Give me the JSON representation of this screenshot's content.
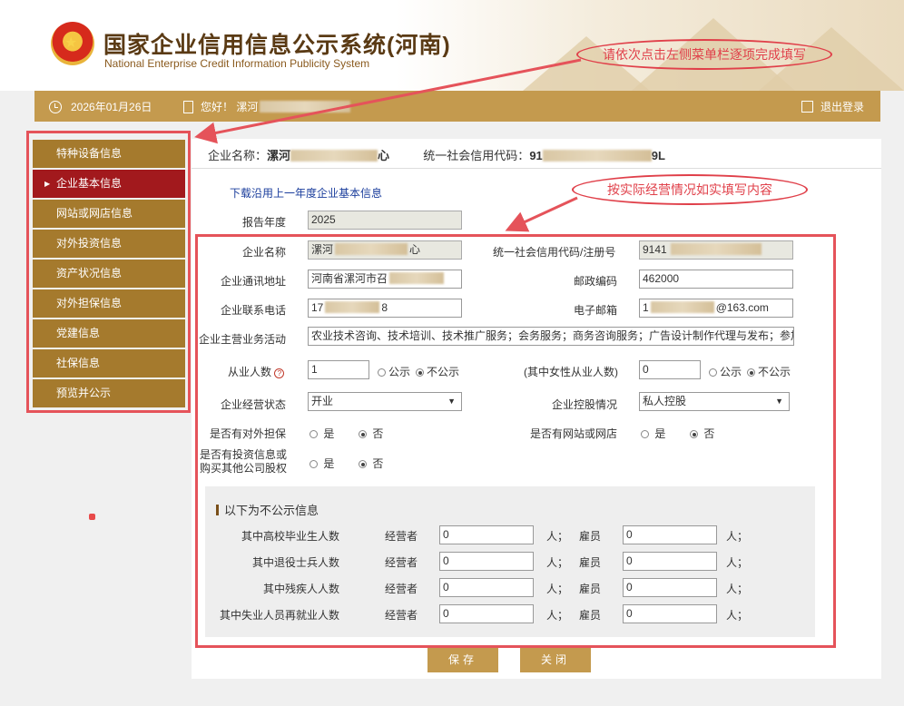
{
  "header": {
    "title_cn": "国家企业信用信息公示系统(河南)",
    "title_en": "National Enterprise Credit Information Publicity System"
  },
  "annotations": {
    "top": "请依次点击左侧菜单栏逐项完成填写",
    "form": "按实际经营情况如实填写内容"
  },
  "topbar": {
    "date": "2026年01月26日",
    "greeting": "您好！ 漯河",
    "logout": "退出登录"
  },
  "sidebar": {
    "items": [
      {
        "label": "特种设备信息"
      },
      {
        "label": "企业基本信息"
      },
      {
        "label": "网站或网店信息"
      },
      {
        "label": "对外投资信息"
      },
      {
        "label": "资产状况信息"
      },
      {
        "label": "对外担保信息"
      },
      {
        "label": "党建信息"
      },
      {
        "label": "社保信息"
      },
      {
        "label": "预览并公示"
      }
    ],
    "active_index": 1
  },
  "company": {
    "name_label": "企业名称：",
    "name_start": "漯河",
    "name_end": "心",
    "credit_label": "统一社会信用代码：",
    "credit_start": "91",
    "credit_end": "9L"
  },
  "form": {
    "download_link": "下载沿用上一年度企业基本信息",
    "report_year_label": "报告年度",
    "report_year": "2025",
    "name_label": "企业名称",
    "name_value": "漯河",
    "name_value_end": "心",
    "credit_label": "统一社会信用代码/注册号",
    "credit_value": "9141",
    "address_label": "企业通讯地址",
    "address_value": "河南省漯河市召",
    "postcode_label": "邮政编码",
    "postcode_value": "462000",
    "phone_label": "企业联系电话",
    "phone_value": "17",
    "phone_value_end": "8",
    "email_label": "电子邮箱",
    "email_value": "1",
    "email_value_end": "@163.com",
    "business_label": "企业主营业务活动",
    "business_value": "农业技术咨询、技术培训、技术推广服务；会务服务；商务咨询服务；广告设计制作代理与发布；参加",
    "employees_label": "从业人数",
    "employees_value": "1",
    "public_label": "公示",
    "nonpublic_label": "不公示",
    "female_label": "(其中女性从业人数)",
    "female_value": "0",
    "status_label": "企业经营状态",
    "status_value": "开业",
    "holding_label": "企业控股情况",
    "holding_value": "私人控股",
    "guarantee_label": "是否有对外担保",
    "website_label": "是否有网站或网店",
    "investment_label_1": "是否有投资信息或",
    "investment_label_2": "购买其他公司股权",
    "yes_label": "是",
    "no_label": "否"
  },
  "nonpublic": {
    "title": "以下为不公示信息",
    "operator_label": "经营者",
    "employee_label": "雇员",
    "unit": "人；",
    "rows": [
      {
        "label": "其中高校毕业生人数",
        "operator": "0",
        "employee": "0"
      },
      {
        "label": "其中退役士兵人数",
        "operator": "0",
        "employee": "0"
      },
      {
        "label": "其中残疾人人数",
        "operator": "0",
        "employee": "0"
      },
      {
        "label": "其中失业人员再就业人数",
        "operator": "0",
        "employee": "0"
      }
    ]
  },
  "buttons": {
    "save": "保存",
    "close": "关闭"
  },
  "colors": {
    "gold": "#c49a4e",
    "sidebar_item": "#a57a2d",
    "sidebar_active": "#a2191d",
    "annotation_red": "#e5535a",
    "link_blue": "#1a3d9c"
  }
}
